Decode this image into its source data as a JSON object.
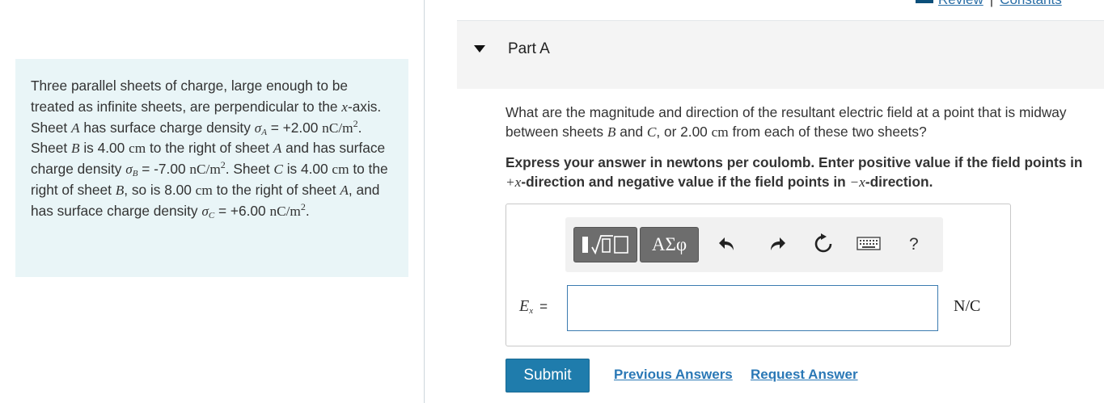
{
  "problem": {
    "t1": "Three parallel sheets of charge, large enough to be treated as infinite sheets, are perpendicular to the ",
    "x": "x",
    "t2": "-axis. Sheet ",
    "A": "A",
    "t3": " has surface charge density ",
    "sigma": "σ",
    "subA": "A",
    "valA": " = +2.00 ",
    "unit_nC": "nC/m",
    "sq": "2",
    "t4": ". Sheet ",
    "B": "B",
    "t5": " is 4.00 ",
    "cm": "cm",
    "t6": " to the right of sheet ",
    "t7": " and has surface charge density ",
    "subB": "B",
    "valB": " = -7.00 ",
    "t8": ". Sheet ",
    "C": "C",
    "t9": " is 4.00 ",
    "t10": " to the right of sheet ",
    "t11": ", so is 8.00 ",
    "t12": " to the right of sheet ",
    "t13": ", and has surface charge density ",
    "subC": "C",
    "valC": " = +6.00 ",
    "end": "."
  },
  "header": {
    "review": "Review",
    "sep": "|",
    "constants": "Constants"
  },
  "part": {
    "title": "Part A"
  },
  "question": {
    "q1": "What are the magnitude and direction of the resultant electric field at a point that is midway between sheets ",
    "B": "B",
    "q2": " and ",
    "C": "C",
    "q3": ", or 2.00 ",
    "cm": "cm",
    "q4": " from each of these two sheets?"
  },
  "instruction": {
    "i1": "Express your answer in newtons per coulomb. Enter positive value if the field points in ",
    "plusx": "+x",
    "i2": "-direction and negative value if the field points in ",
    "minusx": "−x",
    "i3": "-direction."
  },
  "toolbar": {
    "greek_label": "ΑΣφ",
    "help_label": "?",
    "icons": [
      "templates-icon",
      "greek-symbols-icon",
      "undo-icon",
      "redo-icon",
      "reset-icon",
      "keyboard-icon",
      "help-icon"
    ]
  },
  "answer": {
    "var": "E",
    "sub": "x",
    "eq": "=",
    "value": "",
    "units": "N/C"
  },
  "actions": {
    "submit": "Submit",
    "previous": "Previous Answers",
    "request": "Request Answer"
  },
  "colors": {
    "panel_bg": "#e9f5f7",
    "submit_bg": "#1f7cac",
    "link": "#2a78b6",
    "input_border": "#3c7bb0"
  }
}
